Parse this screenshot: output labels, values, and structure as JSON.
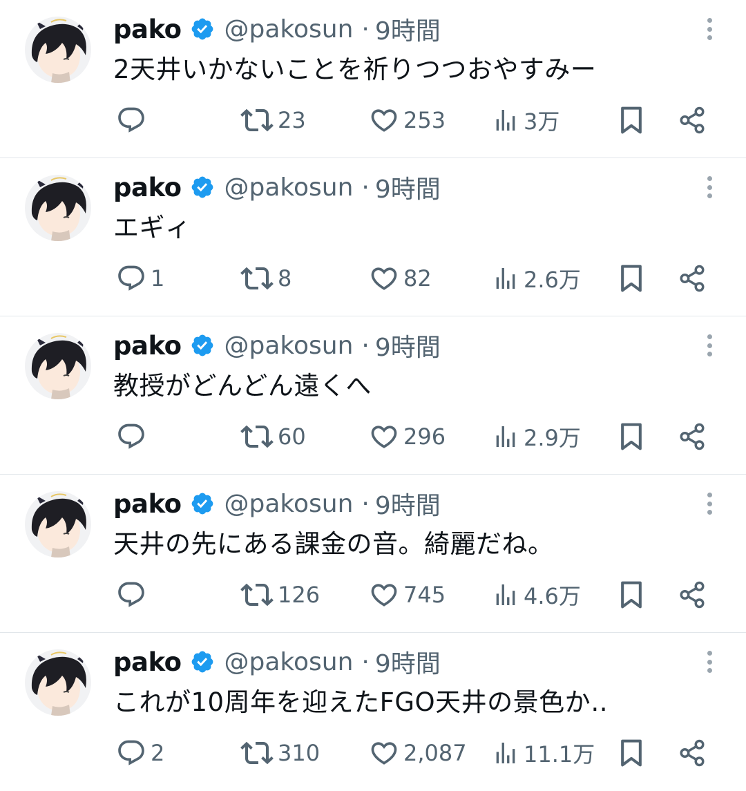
{
  "tweets": [
    {
      "author_name": "pako",
      "handle": "@pakosun",
      "separator": "·",
      "time": "9時間",
      "text": "2天井いかないことを祈りつつおやすみー",
      "replies": "",
      "retweets": "23",
      "likes": "253",
      "views": "3万"
    },
    {
      "author_name": "pako",
      "handle": "@pakosun",
      "separator": "·",
      "time": "9時間",
      "text": "エギィ",
      "replies": "1",
      "retweets": "8",
      "likes": "82",
      "views": "2.6万"
    },
    {
      "author_name": "pako",
      "handle": "@pakosun",
      "separator": "·",
      "time": "9時間",
      "text": "教授がどんどん遠くへ",
      "replies": "",
      "retweets": "60",
      "likes": "296",
      "views": "2.9万"
    },
    {
      "author_name": "pako",
      "handle": "@pakosun",
      "separator": "·",
      "time": "9時間",
      "text": "天井の先にある課金の音。綺麗だね。",
      "replies": "",
      "retweets": "126",
      "likes": "745",
      "views": "4.6万"
    },
    {
      "author_name": "pako",
      "handle": "@pakosun",
      "separator": "·",
      "time": "9時間",
      "text": "これが10周年を迎えたFGO天井の景色か‥",
      "replies": "2",
      "retweets": "310",
      "likes": "2,087",
      "views": "11.1万"
    }
  ],
  "colors": {
    "text_primary": "#0f1419",
    "text_secondary": "#536471",
    "verified_badge": "#1d9bf0",
    "divider": "#e1e6ea"
  },
  "icons": [
    "avatar",
    "verified-badge-icon",
    "more-icon",
    "reply-icon",
    "retweet-icon",
    "like-icon",
    "views-icon",
    "bookmark-icon",
    "share-icon"
  ]
}
